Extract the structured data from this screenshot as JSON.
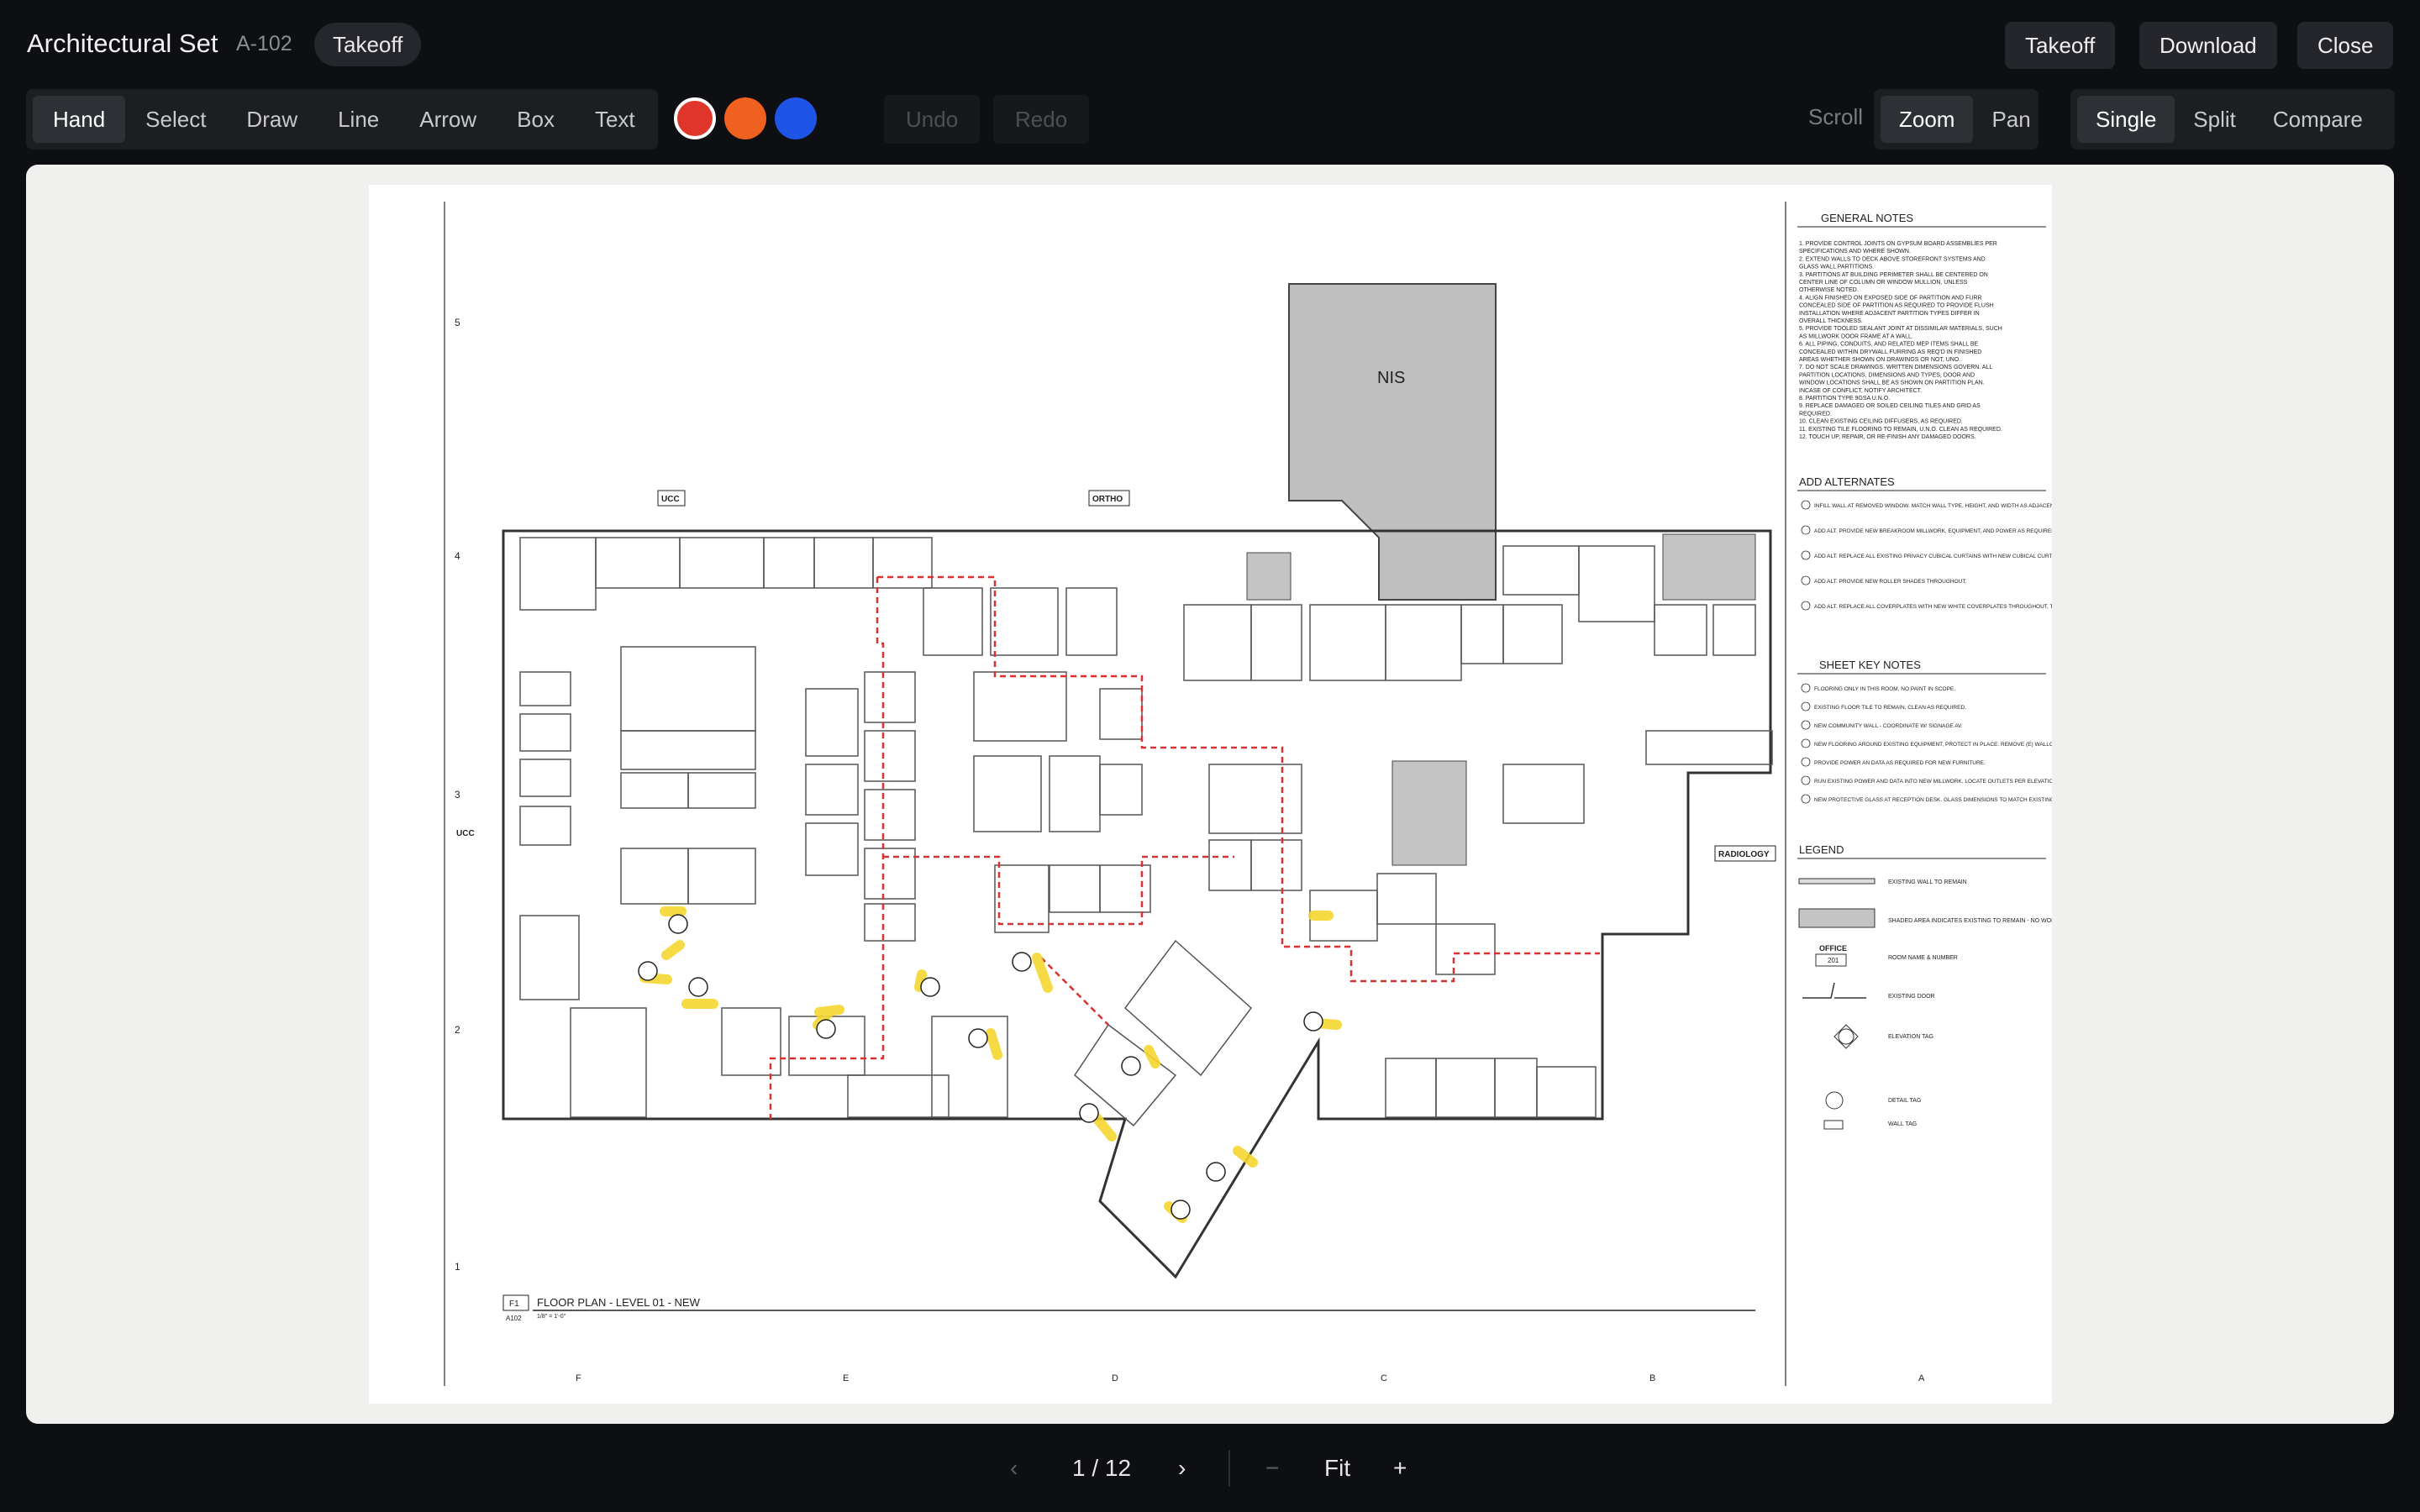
{
  "header": {
    "title": "Architectural Set",
    "sheet_id": "A-102",
    "mode_chip": "Takeoff",
    "buttons": {
      "takeoff": "Takeoff",
      "download": "Download",
      "close": "Close"
    }
  },
  "toolbar": {
    "tools": [
      "Hand",
      "Select",
      "Draw",
      "Line",
      "Arrow",
      "Box",
      "Text"
    ],
    "active_tool": "Hand",
    "colors": [
      "#e0352b",
      "#f0601e",
      "#1f55e6"
    ],
    "active_color": "#e0352b",
    "undo": "Undo",
    "redo": "Redo",
    "scroll_label": "Scroll",
    "scroll_modes": [
      "Zoom",
      "Pan"
    ],
    "active_scroll": "Zoom",
    "view_modes": [
      "Single",
      "Split",
      "Compare"
    ],
    "active_view": "Single"
  },
  "pager": {
    "prev_icon": "chevron-left-icon",
    "page": "1 / 12",
    "next_icon": "chevron-right-icon",
    "zoom_out": "−",
    "fit": "Fit",
    "zoom_in": "+"
  },
  "drawing": {
    "title_key": "F1",
    "title_sheet": "A102",
    "title": "FLOOR PLAN - LEVEL 01 - NEW",
    "scale": "1/8\" = 1'-0\"",
    "labels": {
      "nis": "NIS",
      "ucc": "UCC",
      "ortho": "ORTHO",
      "ucc_left": "UCC",
      "radiology": "RADIOLOGY"
    },
    "grid_rows": [
      "5",
      "4",
      "3",
      "2",
      "1"
    ],
    "grid_cols": [
      "F",
      "E",
      "D",
      "C",
      "B",
      "A"
    ],
    "general_notes_title": "GENERAL NOTES",
    "general_notes": [
      "1. PROVIDE CONTROL JOINTS ON GYPSUM BOARD ASSEMBLIES PER",
      "SPECIFICATIONS AND WHERE SHOWN.",
      "2. EXTEND WALLS TO DECK ABOVE STOREFRONT SYSTEMS AND",
      "GLASS WALL PARTITIONS.",
      "3. PARTITIONS AT BUILDING PERIMETER SHALL BE CENTERED ON",
      "CENTER LINE OF COLUMN OR WINDOW MULLION, UNLESS",
      "OTHERWISE NOTED.",
      "4. ALIGN FINISHED ON EXPOSED SIDE OF PARTITION AND FURR",
      "CONCEALED SIDE OF PARTITION AS REQUIRED TO PROVIDE FLUSH",
      "INSTALLATION WHERE ADJACENT PARTITION TYPES DIFFER IN",
      "OVERALL THICKNESS.",
      "5. PROVIDE TOOLED SEALANT JOINT AT DISSIMILAR MATERIALS, SUCH",
      "AS MILLWORK DOOR FRAME AT A WALL.",
      "6. ALL PIPING, CONDUITS, AND RELATED MEP ITEMS SHALL BE",
      "CONCEALED WITHIN DRYWALL FURRING AS REQ'D IN FINISHED",
      "AREAS WHETHER SHOWN ON DRAWINGS OR NOT, UNO.",
      "7. DO NOT SCALE DRAWINGS. WRITTEN DIMENSIONS GOVERN. ALL",
      "PARTITION LOCATIONS, DIMENSIONS AND TYPES, DOOR AND",
      "WINDOW LOCATIONS SHALL BE AS SHOWN ON PARTITION PLAN.",
      "INCASE OF CONFLICT, NOTIFY ARCHITECT.",
      "8. PARTITION TYPE 9GSA U.N.O.",
      "9. REPLACE DAMAGED OR SOILED CEILING TILES AND GRID AS",
      "REQUIRED.",
      "10. CLEAN EXISTING CEILING DIFFUSERS, AS REQUIRED.",
      "11. EXISTING TILE FLOORING TO REMAIN, U.N.O. CLEAN AS REQUIRED.",
      "12. TOUCH UP, REPAIR, OR RE-FINISH ANY DAMAGED DOORS."
    ],
    "alternates_title": "ADD ALTERNATES",
    "alternates": [
      "INFILL WALL AT REMOVED WINDOW. MATCH WALL TYPE, HEIGHT, AND WIDTH AS ADJACENT WALLS.",
      "ADD ALT. PROVIDE NEW BREAKROOM MILLWORK, EQUIPMENT, AND POWER AS REQUIRED.",
      "ADD ALT. REPLACE ALL EXISTING PRIVACY CUBICAL CURTAINS WITH NEW CUBICAL CURTAINS.",
      "ADD ALT. PROVIDE NEW ROLLER SHADES THROUGHOUT.",
      "ADD ALT. REPLACE ALL COVERPLATES WITH NEW WHITE COVERPLATES THROUGHOUT, TYP."
    ],
    "keynotes_title": "SHEET KEY NOTES",
    "keynotes": [
      "FLOORING ONLY IN THIS ROOM, NO PAINT IN SCOPE.",
      "EXISTING FLOOR TILE TO REMAIN, CLEAN AS REQUIRED.",
      "NEW COMMUNITY WALL - COORDINATE W/ SIGNAGE AV.",
      "NEW FLOORING AROUND EXISTING EQUIPMENT, PROTECT IN PLACE. REMOVE (E) WALLCOVERING AND CEILING TRIM.",
      "PROVIDE POWER AN DATA AS REQUIRED FOR NEW FURNITURE.",
      "RUN EXISTING POWER AND DATA INTO NEW MILLWORK. LOCATE OUTLETS PER ELEVATIONS.",
      "NEW PROTECTIVE GLASS AT RECEPTION DESK. GLASS DIMENSIONS TO MATCH EXISTING CONDITIONS."
    ],
    "legend_title": "LEGEND",
    "legend": [
      "EXISTING WALL TO REMAIN",
      "SHADED AREA INDICATES EXISTING TO REMAIN - NO WORK THIS AREA",
      "ROOM NAME & NUMBER",
      "EXISTING DOOR",
      "ELEVATION TAG",
      "DETAIL TAG",
      "WALL TAG"
    ],
    "legend_office": "OFFICE",
    "legend_room_num": "201"
  }
}
